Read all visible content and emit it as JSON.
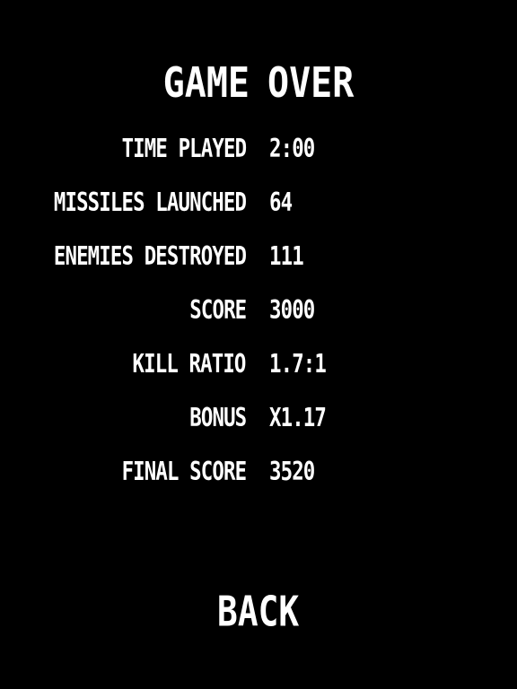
{
  "title": {
    "word1": "GAME",
    "word2": "OVER"
  },
  "stats": [
    {
      "label": "TIME PLAYED",
      "value": "2:00"
    },
    {
      "label": "MISSILES LAUNCHED",
      "value": "64"
    },
    {
      "label": "ENEMIES DESTROYED",
      "value": "111"
    },
    {
      "label": "SCORE",
      "value": "3000"
    },
    {
      "label": "KILL RATIO",
      "value": "1.7:1"
    },
    {
      "label": "BONUS",
      "value": "X1.17"
    },
    {
      "label": "FINAL SCORE",
      "value": "3520"
    }
  ],
  "back_label": "BACK",
  "colors": {
    "background": "#000000",
    "text": "#ffffff"
  }
}
